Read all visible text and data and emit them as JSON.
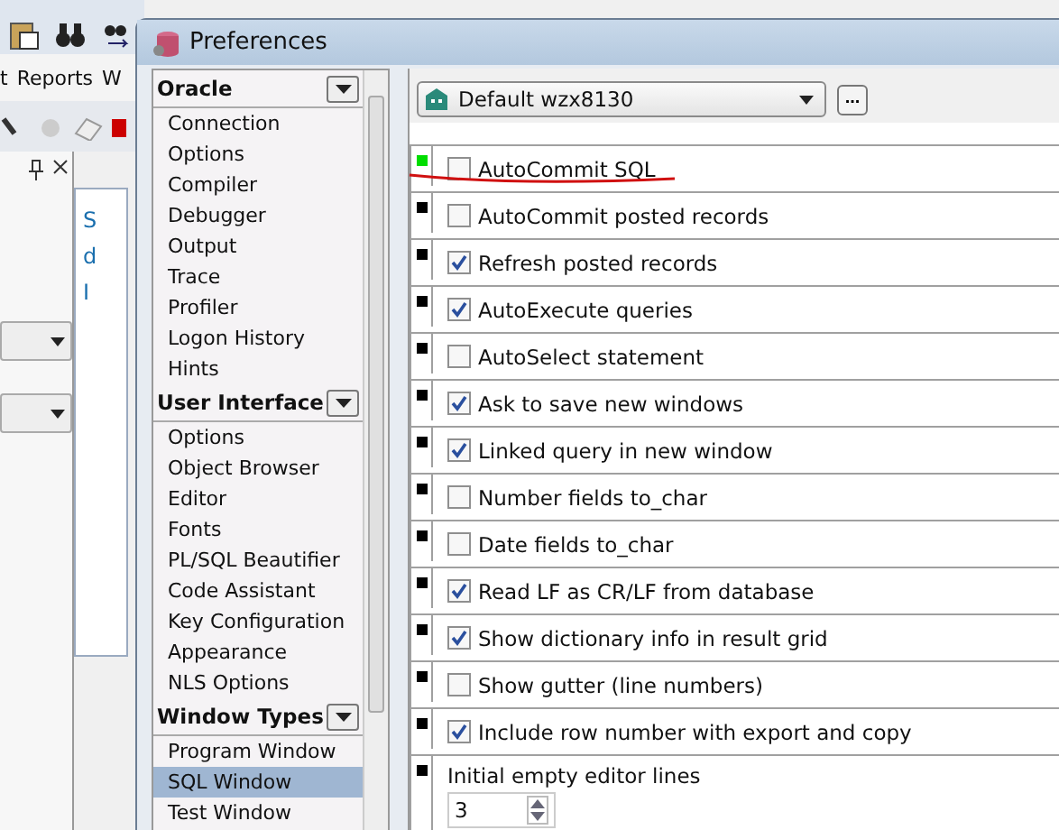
{
  "background_app": {
    "menu": [
      "t",
      "Reports",
      "W"
    ],
    "panel_letters": [
      "S",
      "d",
      "I"
    ]
  },
  "window": {
    "title": "Preferences"
  },
  "sidebar": {
    "groups": [
      {
        "title": "Oracle",
        "items": [
          {
            "label": "Connection",
            "selected": false
          },
          {
            "label": "Options",
            "selected": false
          },
          {
            "label": "Compiler",
            "selected": false
          },
          {
            "label": "Debugger",
            "selected": false
          },
          {
            "label": "Output",
            "selected": false
          },
          {
            "label": "Trace",
            "selected": false
          },
          {
            "label": "Profiler",
            "selected": false
          },
          {
            "label": "Logon History",
            "selected": false
          },
          {
            "label": "Hints",
            "selected": false
          }
        ]
      },
      {
        "title": "User Interface",
        "items": [
          {
            "label": "Options",
            "selected": false
          },
          {
            "label": "Object Browser",
            "selected": false
          },
          {
            "label": "Editor",
            "selected": false
          },
          {
            "label": "Fonts",
            "selected": false
          },
          {
            "label": "PL/SQL Beautifier",
            "selected": false
          },
          {
            "label": "Code Assistant",
            "selected": false
          },
          {
            "label": "Key Configuration",
            "selected": false
          },
          {
            "label": "Appearance",
            "selected": false
          },
          {
            "label": "NLS Options",
            "selected": false
          }
        ]
      },
      {
        "title": "Window Types",
        "items": [
          {
            "label": "Program Window",
            "selected": false
          },
          {
            "label": "SQL Window",
            "selected": true
          },
          {
            "label": "Test Window",
            "selected": false
          }
        ]
      }
    ]
  },
  "profile": {
    "value": "Default wzx8130",
    "button": "..."
  },
  "options": [
    {
      "kind": "checkbox",
      "label": "AutoCommit SQL",
      "checked": false,
      "color": "#00dd00"
    },
    {
      "kind": "checkbox",
      "label": "AutoCommit posted records",
      "checked": false,
      "color": "#000000"
    },
    {
      "kind": "checkbox",
      "label": "Refresh posted records",
      "checked": true,
      "color": "#000000"
    },
    {
      "kind": "checkbox",
      "label": "AutoExecute queries",
      "checked": true,
      "color": "#000000"
    },
    {
      "kind": "checkbox",
      "label": "AutoSelect statement",
      "checked": false,
      "color": "#000000"
    },
    {
      "kind": "checkbox",
      "label": "Ask to save new windows",
      "checked": true,
      "color": "#000000"
    },
    {
      "kind": "checkbox",
      "label": "Linked query in new window",
      "checked": true,
      "color": "#000000"
    },
    {
      "kind": "checkbox",
      "label": "Number fields to_char",
      "checked": false,
      "color": "#000000"
    },
    {
      "kind": "checkbox",
      "label": "Date fields to_char",
      "checked": false,
      "color": "#000000"
    },
    {
      "kind": "checkbox",
      "label": "Read LF as CR/LF from database",
      "checked": true,
      "color": "#000000"
    },
    {
      "kind": "checkbox",
      "label": "Show dictionary info in result grid",
      "checked": true,
      "color": "#000000"
    },
    {
      "kind": "checkbox",
      "label": "Show gutter (line numbers)",
      "checked": false,
      "color": "#000000"
    },
    {
      "kind": "checkbox",
      "label": "Include row number with export and copy",
      "checked": true,
      "color": "#000000"
    },
    {
      "kind": "number",
      "label": "Initial empty editor lines",
      "value": "3",
      "color": "#000000"
    }
  ]
}
